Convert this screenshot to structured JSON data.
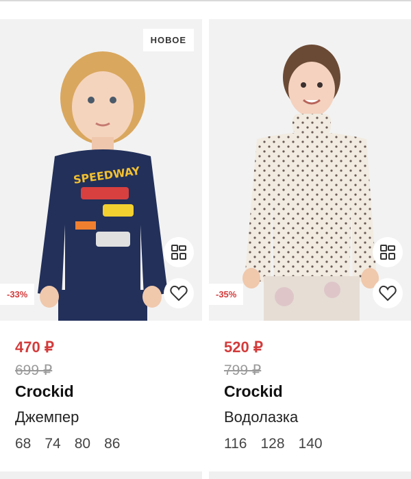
{
  "products": [
    {
      "badge": "НОВОЕ",
      "discount": "-33%",
      "price": "470 ₽",
      "old_price": "699 ₽",
      "brand": "Crockid",
      "title": "Джемпер",
      "sizes": [
        "68",
        "74",
        "80",
        "86"
      ],
      "print_text": [
        "SPEEDWAY"
      ]
    },
    {
      "discount": "-35%",
      "price": "520 ₽",
      "old_price": "799 ₽",
      "brand": "Crockid",
      "title": "Водолазка",
      "sizes": [
        "116",
        "128",
        "140"
      ]
    }
  ],
  "icons": {
    "similar": "similar-items-grid-icon",
    "favorite": "heart-icon"
  },
  "colors": {
    "price_red": "#d33b3b",
    "old_price_gray": "#9a9a9a",
    "photo_bg": "#f2f2f2"
  }
}
